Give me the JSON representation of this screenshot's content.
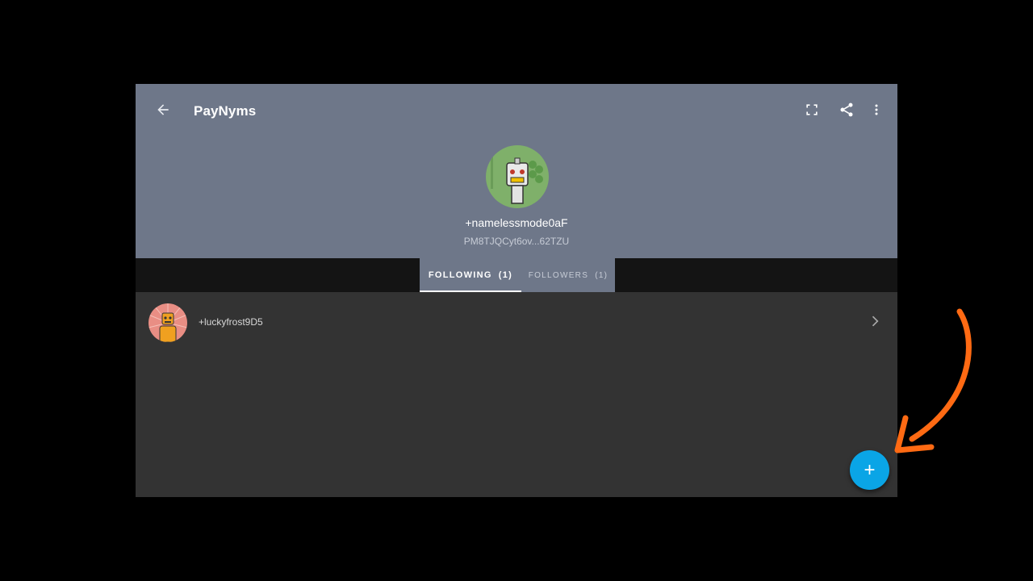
{
  "topbar": {
    "back_icon": "arrow-back-icon",
    "title": "PayNyms",
    "actions": [
      "fullscreen-icon",
      "share-icon",
      "more-vert-icon"
    ]
  },
  "profile": {
    "avatar": "robot-avatar",
    "name": "+namelessmode0aF",
    "code": "PM8TJQCyt6ov...62TZU"
  },
  "tabs": [
    {
      "label": "FOLLOWING",
      "count": "(1)",
      "selected": true
    },
    {
      "label": "FOLLOWERS",
      "count": "(1)",
      "selected": false
    }
  ],
  "following": [
    {
      "name": "+luckyfrost9D5",
      "avatar": "robot-avatar"
    }
  ],
  "fab": {
    "label": "+",
    "icon": "plus-icon"
  },
  "colors": {
    "header": "#6e7789",
    "background": "#333333",
    "tabstrip": "#141414",
    "fab": "#0aa5e6",
    "annotation": "#ff6a13"
  }
}
